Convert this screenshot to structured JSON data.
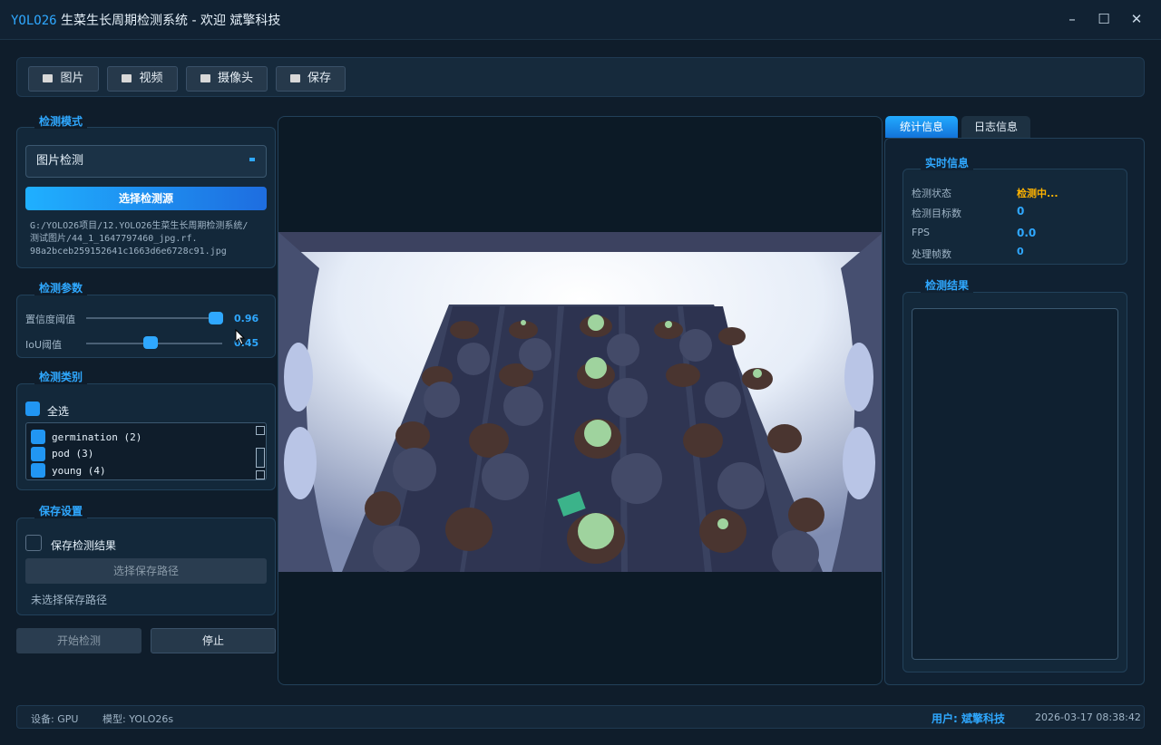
{
  "window": {
    "brand": "YOLO26",
    "title_rest": "生菜生长周期检测系统 - 欢迎 斌擎科技",
    "minimize": "–",
    "maximize": "☐",
    "close": "✕"
  },
  "toolbar": {
    "image": "图片",
    "video": "视频",
    "camera": "摄像头",
    "save": "保存"
  },
  "detect_mode": {
    "title": "检测模式",
    "selected": "图片检测",
    "select_source": "选择检测源",
    "path_lines": [
      "G:/YOLO26项目/12.YOLO26生菜生长周期检测系统/",
      "测试图片/44_1_1647797460_jpg.rf.",
      "98a2bceb259152641c1663d6e6728c91.jpg"
    ]
  },
  "detect_params": {
    "title": "检测参数",
    "confidence_label": "置信度阈值",
    "confidence_value": "0.96",
    "iou_label": "IoU阈值",
    "iou_value": "0.45"
  },
  "detect_classes": {
    "title": "检测类别",
    "select_all": "全选",
    "classes": [
      "germination (2)",
      "pod (3)",
      "young (4)"
    ]
  },
  "save_settings": {
    "title": "保存设置",
    "save_results": "保存检测结果",
    "choose_path": "选择保存路径",
    "path_status": "未选择保存路径"
  },
  "actions": {
    "start": "开始检测",
    "stop": "停止"
  },
  "tabs": {
    "stats": "统计信息",
    "log": "日志信息"
  },
  "realtime": {
    "title": "实时信息",
    "status_label": "检测状态",
    "status_value": "检测中...",
    "targets_label": "检测目标数",
    "targets_value": "0",
    "fps_label": "FPS",
    "fps_value": "0.0",
    "frames_label": "处理帧数",
    "frames_value": "0"
  },
  "results": {
    "title": "检测结果"
  },
  "statusbar": {
    "device": "设备: GPU",
    "model": "模型: YOLO26s",
    "user": "用户: 斌擎科技",
    "datetime": "2026-03-17 08:38:42"
  },
  "colors": {
    "accent": "#2fa8ff",
    "warning": "#ffb300",
    "background": "#0f1d2b"
  }
}
